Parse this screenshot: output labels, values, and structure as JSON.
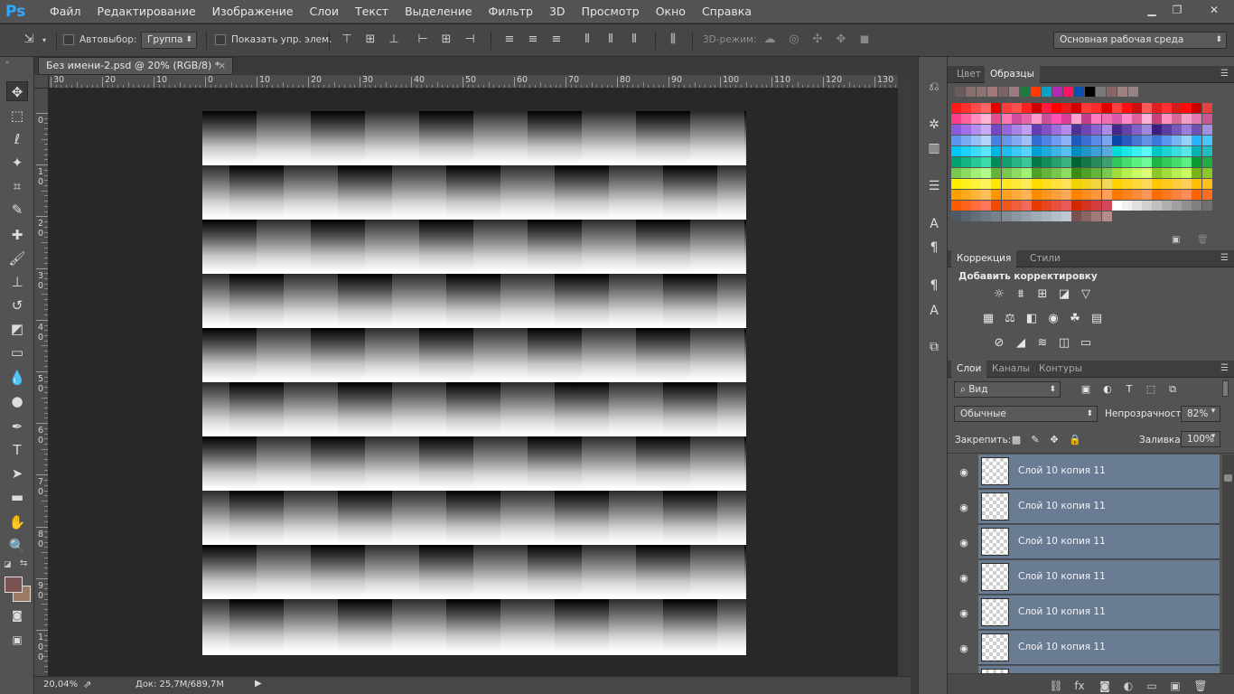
{
  "app": {
    "logo": "Ps"
  },
  "menu": [
    "Файл",
    "Редактирование",
    "Изображение",
    "Слои",
    "Текст",
    "Выделение",
    "Фильтр",
    "3D",
    "Просмотр",
    "Окно",
    "Справка"
  ],
  "window_controls": [
    "minimize-icon",
    "restore-icon",
    "close-icon"
  ],
  "options": {
    "autoselect_label": "Автовыбор:",
    "autoselect_value": "Группа",
    "show_controls_label": "Показать упр. элем.",
    "mode_3d_label": "3D-режим:",
    "workspace_value": "Основная рабочая среда"
  },
  "document": {
    "tab_title": "Без имени-2.psd @ 20% (RGB/8) *",
    "close_glyph": "×",
    "ruler_h_ticks": [
      "30",
      "20",
      "10",
      "0",
      "10",
      "20",
      "30",
      "40",
      "50",
      "60",
      "70",
      "80",
      "90",
      "100",
      "110",
      "120",
      "130"
    ],
    "ruler_v_ticks": [
      [
        "0"
      ],
      [
        "1",
        "0"
      ],
      [
        "2",
        "0"
      ],
      [
        "3",
        "0"
      ],
      [
        "4",
        "0"
      ],
      [
        "5",
        "0"
      ],
      [
        "6",
        "0"
      ],
      [
        "7",
        "0"
      ],
      [
        "8",
        "0"
      ],
      [
        "9",
        "0"
      ],
      [
        "1",
        "0",
        "0"
      ]
    ],
    "zoom": "20,04%",
    "doc_info": "Док: 25,7M/689,7M"
  },
  "swatches_panel": {
    "tabs": [
      "Цвет",
      "Образцы"
    ],
    "active_tab": "Образцы",
    "recent_colors": [
      "#6b5a5a",
      "#8a6e6e",
      "#8c7272",
      "#a07878",
      "#7c6464",
      "#9a7c7c",
      "#1e7a3c",
      "#ff3b00",
      "#0aa0c8",
      "#b428b4",
      "#ff1464",
      "#0a50b4",
      "#000000",
      "#7a7a7a",
      "#8c6464",
      "#a08080",
      "#968282"
    ]
  },
  "adjustments_panel": {
    "tabs": [
      "Коррекция",
      "Стили"
    ],
    "active_tab": "Коррекция",
    "heading": "Добавить корректировку",
    "rows": [
      [
        "brightness-icon",
        "levels-icon",
        "curves-icon",
        "exposure-icon",
        "triangle-icon"
      ],
      [
        "vibrance-icon",
        "balance-icon",
        "bw-icon",
        "photo-filter-icon",
        "channel-mixer-icon",
        "color-lookup-icon"
      ],
      [
        "invert-icon",
        "posterize-icon",
        "threshold-icon",
        "selective-color-icon",
        "gradient-map-icon"
      ]
    ],
    "glyphs": [
      "☼",
      "⩩",
      "⊞",
      "◪",
      "▽",
      "▦",
      "⚖",
      "◧",
      "◉",
      "☘",
      "▤",
      "⊘",
      "◢",
      "≋",
      "◫",
      "▭"
    ]
  },
  "layers_panel": {
    "tabs": [
      "Слои",
      "Каналы",
      "Контуры"
    ],
    "active_tab": "Слои",
    "filter_kind": "Вид",
    "blend_mode": "Обычные",
    "opacity_label": "Непрозрачность:",
    "opacity_value": "82%",
    "lock_label": "Закрепить:",
    "fill_label": "Заливка:",
    "fill_value": "100%",
    "layers": [
      {
        "name": "Слой 10 копия 11",
        "visible": true,
        "selected": true
      },
      {
        "name": "Слой 10 копия 11",
        "visible": true,
        "selected": true
      },
      {
        "name": "Слой 10 копия 11",
        "visible": true,
        "selected": true
      },
      {
        "name": "Слой 10 копия 11",
        "visible": true,
        "selected": true
      },
      {
        "name": "Слой 10 копия 11",
        "visible": true,
        "selected": true
      },
      {
        "name": "Слой 10 копия 11",
        "visible": true,
        "selected": true
      }
    ]
  },
  "colors": {
    "accent": "#31a8ff",
    "layer_selected": "#6a7b94",
    "foreground": "#7a5252",
    "background": "#9b7b63"
  }
}
